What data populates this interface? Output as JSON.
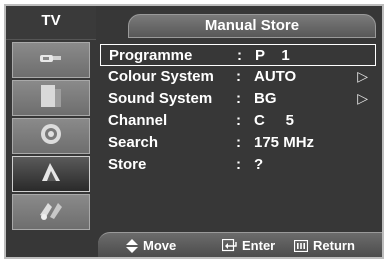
{
  "sidebar": {
    "title": "TV",
    "items": [
      {
        "icon": "antenna-icon",
        "active": false
      },
      {
        "icon": "picture-icon",
        "active": false
      },
      {
        "icon": "sound-icon",
        "active": false
      },
      {
        "icon": "channel-icon",
        "active": true
      },
      {
        "icon": "setup-icon",
        "active": false
      }
    ]
  },
  "menu": {
    "title": "Manual Store",
    "rows": [
      {
        "label": "Programme",
        "value": "P    1",
        "selected": true,
        "arrow": ""
      },
      {
        "label": "Colour System",
        "value": "AUTO",
        "selected": false,
        "arrow": "▷"
      },
      {
        "label": "Sound System",
        "value": "BG",
        "selected": false,
        "arrow": "▷"
      },
      {
        "label": "Channel",
        "value": "C     5",
        "selected": false,
        "arrow": ""
      },
      {
        "label": "Search",
        "value": "175 MHz",
        "selected": false,
        "arrow": ""
      },
      {
        "label": "Store",
        "value": "?",
        "selected": false,
        "arrow": ""
      }
    ],
    "separator": ":"
  },
  "footer": {
    "move_label": "Move",
    "move_icon": "updown-arrow-icon",
    "enter_label": "Enter",
    "enter_icon": "enter-icon",
    "return_label": "Return",
    "return_icon": "return-icon"
  },
  "colors": {
    "background": "#373737",
    "text": "#ffffff",
    "border": "#bdbdbd"
  }
}
